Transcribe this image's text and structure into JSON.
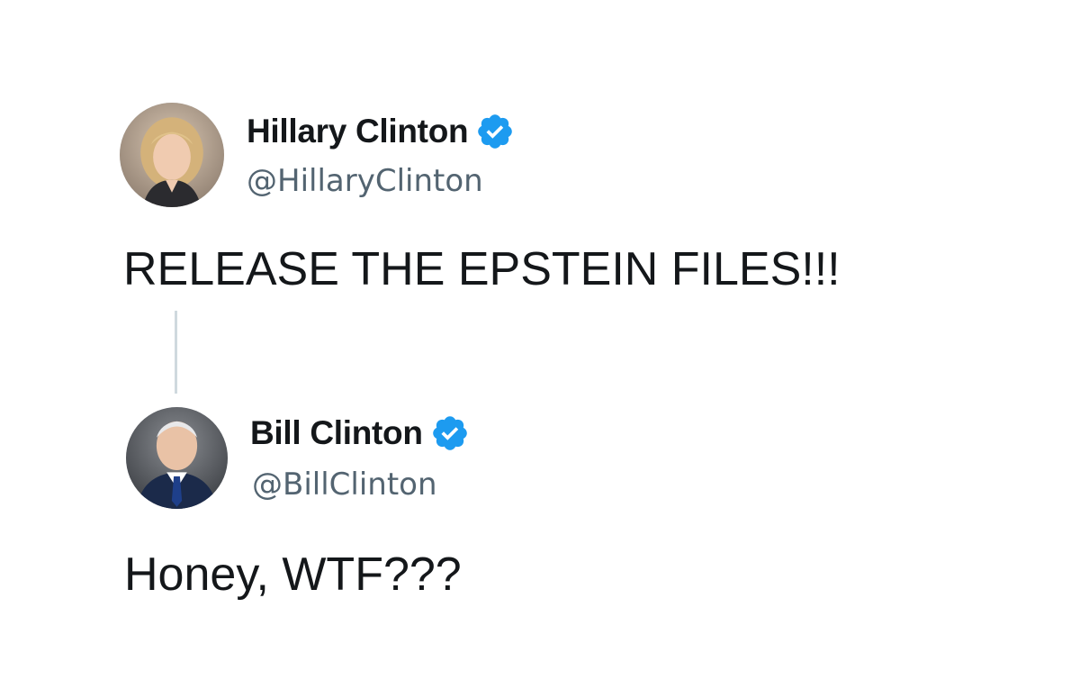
{
  "posts": [
    {
      "author_name": "Hillary Clinton",
      "handle": "@HillaryClinton",
      "verified": true,
      "avatar": "hillary-clinton-portrait",
      "text": "RELEASE THE EPSTEIN FILES!!!"
    },
    {
      "author_name": "Bill Clinton",
      "handle": "@BillClinton",
      "verified": true,
      "avatar": "bill-clinton-portrait",
      "text": "Honey, WTF???"
    }
  ],
  "icons": {
    "verified": "verified-badge-icon"
  },
  "colors": {
    "verified_blue": "#1d9bf0",
    "text_primary": "#14171a",
    "text_secondary": "#536471",
    "thread_line": "#cfd9de",
    "background": "#ffffff"
  }
}
